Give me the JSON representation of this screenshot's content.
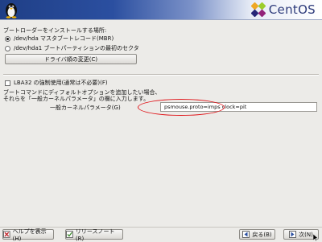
{
  "header": {
    "brand": "CentOS"
  },
  "bootloader": {
    "title": "ブートローダーをインストールする場所:",
    "options": [
      {
        "label": "/dev/hda マスタブートレコード(MBR)",
        "selected": true
      },
      {
        "label": "/dev/hda1 ブートパーティションの最初のセクタ",
        "selected": false
      }
    ],
    "drive_order_button": "ドライバ順の変更(C)"
  },
  "lba32": {
    "label": "LBA32 の強制使用(通常は不必要)(F)",
    "checked": false
  },
  "kernel": {
    "description_line1": "ブートコマンドにディフォルトオプションを追加したい場合、",
    "description_line2": "それらを「一般カーネルパラメータ」の欄に入力します。",
    "label": "一般カーネルパラメータ(G)",
    "value": "psmouse.proto=imps clock=pit"
  },
  "footer": {
    "help_button": "ヘルプを表示(H)",
    "release_notes_button": "リリースノート(R)",
    "back_button": "戻る(B)",
    "next_button": "次(N)"
  },
  "colors": {
    "highlight": "#e0161b",
    "header_dark": "#1f3f86"
  }
}
